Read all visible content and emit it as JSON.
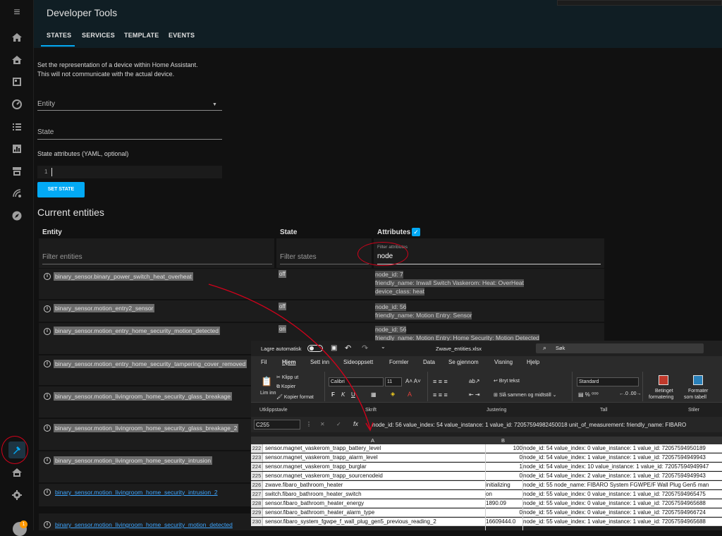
{
  "rail": {
    "icons": [
      "menu-icon",
      "home-icon",
      "home-alt-icon",
      "map-icon",
      "gauge-icon",
      "list-icon",
      "chart-icon",
      "store-icon",
      "radar-icon",
      "compass-icon",
      "hammer-icon",
      "home-outline-icon",
      "gear-icon",
      "avatar"
    ],
    "badge": "1"
  },
  "header": {
    "title": "Developer Tools",
    "tabs": [
      "STATES",
      "SERVICES",
      "TEMPLATE",
      "EVENTS"
    ]
  },
  "form": {
    "intro_1": "Set the representation of a device within Home Assistant.",
    "intro_2": "This will not communicate with the actual device.",
    "entity_label": "Entity",
    "state_label": "State",
    "attributes_label": "State attributes (YAML, optional)",
    "yaml_line": "1",
    "set_state_button": "SET STATE"
  },
  "entities": {
    "heading": "Current entities",
    "col_entity": "Entity",
    "col_state": "State",
    "col_attributes": "Attributes",
    "filter_entities": "Filter entities",
    "filter_states": "Filter states",
    "filter_attributes_label": "Filter attributes",
    "filter_attributes_value": "node",
    "rows": [
      {
        "entity": "binary_sensor.binary_power_switch_heat_overheat",
        "state": "off",
        "attrs": [
          "node_id: 7",
          "friendly_name: Inwall Switch Vaskerom: Heat: OverHeat",
          "device_class: heat"
        ]
      },
      {
        "entity": "binary_sensor.motion_entry2_sensor",
        "state": "off",
        "attrs": [
          "node_id: 56",
          "friendly_name: Motion Entry: Sensor"
        ]
      },
      {
        "entity": "binary_sensor.motion_entry_home_security_motion_detected",
        "state": "on",
        "attrs": [
          "node_id: 56",
          "friendly_name: Motion Entry: Home Security: Motion Detected"
        ]
      },
      {
        "entity": "binary_sensor.motion_entry_home_security_tampering_cover_removed",
        "state": "",
        "attrs": []
      },
      {
        "entity": "binary_sensor.motion_livingroom_home_security_glass_breakage",
        "state": "",
        "attrs": []
      },
      {
        "entity": "binary_sensor.motion_livingroom_home_security_glass_breakage_2",
        "state": "",
        "attrs": []
      },
      {
        "entity": "binary_sensor.motion_livingroom_home_security_intrusion",
        "state": "",
        "attrs": []
      },
      {
        "entity": "binary_sensor.motion_livingroom_home_security_intrusion_2",
        "state": "",
        "attrs": []
      },
      {
        "entity": "binary_sensor.motion_livingroom_home_security_motion_detected",
        "state": "",
        "attrs": []
      }
    ]
  },
  "excel": {
    "autosave_label": "Lagre automatisk",
    "filename": "Zwave_entities.xlsx",
    "search_placeholder": "Søk",
    "menu": [
      "Fil",
      "Hjem",
      "Sett inn",
      "Sideoppsett",
      "Formler",
      "Data",
      "Se gjennom",
      "Visning",
      "Hjelp"
    ],
    "ribbon": {
      "paste": "Lim inn",
      "cut": "Klipp ut",
      "copy": "Kopier",
      "format_painter": "Kopier format",
      "font_name": "Calibri",
      "font_size": "11",
      "wrap_text": "Bryt tekst",
      "merge_center": "Slå sammen og midtstill",
      "number_format": "Standard",
      "cond_format_1": "Betinget",
      "cond_format_2": "formatering",
      "format_table_1": "Formater",
      "format_table_2": "som tabell",
      "groups": [
        "Utklippstavle",
        "Skrift",
        "Justering",
        "Tall",
        "Stiler"
      ]
    },
    "name_box": "C255",
    "formula": "node_id: 56 value_index: 54 value_instance: 1 value_id: 72057594982450018 unit_of_measurement: friendly_name: FIBARO",
    "col_a": "A",
    "col_b": "B",
    "rows": [
      {
        "n": "222",
        "a": "sensor.magnet_vaskerom_trapp_battery_level",
        "b": "100",
        "c": "node_id: 54 value_index: 0 value_instance: 1 value_id: 72057594950189"
      },
      {
        "n": "223",
        "a": "sensor.magnet_vaskerom_trapp_alarm_level",
        "b": "0",
        "c": "node_id: 54 value_index: 1 value_instance: 1 value_id: 72057594949943"
      },
      {
        "n": "224",
        "a": "sensor.magnet_vaskerom_trapp_burglar",
        "b": "1",
        "c": "node_id: 54 value_index: 10 value_instance: 1 value_id: 72057594949947"
      },
      {
        "n": "225",
        "a": "sensor.magnet_vaskerom_trapp_sourcenodeid",
        "b": "0",
        "c": "node_id: 54 value_index: 2 value_instance: 1 value_id: 72057594949943"
      },
      {
        "n": "226",
        "a": "zwave.fibaro_bathroom_heater",
        "b": "initializing",
        "c": "node_id: 55 node_name: FIBARO System FGWPE/F Wall Plug Gen5 man"
      },
      {
        "n": "227",
        "a": "switch.fibaro_bathroom_heater_switch",
        "b": "on",
        "c": "node_id: 55 value_index: 0 value_instance: 1 value_id: 72057594965475"
      },
      {
        "n": "228",
        "a": "sensor.fibaro_bathroom_heater_energy",
        "b": "1890.09",
        "c": "node_id: 55 value_index: 0 value_instance: 1 value_id: 72057594965688"
      },
      {
        "n": "229",
        "a": "sensor.fibaro_bathroom_heater_alarm_type",
        "b": "0",
        "c": "node_id: 55 value_index: 0 value_instance: 1 value_id: 72057594966724"
      },
      {
        "n": "230",
        "a": "sensor.fibaro_system_fgwpe_f_wall_plug_gen5_previous_reading_2",
        "b": "16609444.0",
        "c": "node_id: 55 value_index: 1 value_instance: 1 value_id: 72057594965688"
      }
    ]
  }
}
